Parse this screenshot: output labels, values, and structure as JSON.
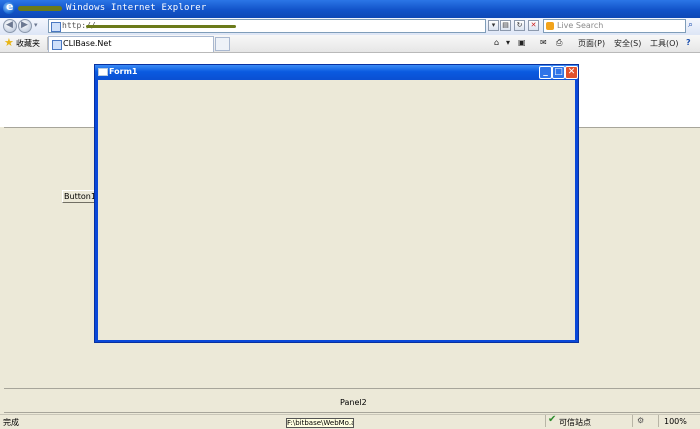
{
  "window": {
    "title": "Windows Internet Explorer",
    "logo_letter": "e"
  },
  "address_bar": {
    "url_prefix": "http://",
    "back_glyph": "◀",
    "forward_glyph": "▶",
    "dropdown_glyph": "▾",
    "refresh_glyph": "↻",
    "stop_glyph": "✕",
    "compat_glyph": "▤",
    "search_placeholder": "Live Search",
    "search_glyph": "⌕"
  },
  "command_bar": {
    "favorites_label": "收藏夹",
    "tab_label": "CLIBase.Net",
    "home_glyph": "⌂",
    "feeds_glyph": "▣",
    "mail_glyph": "✉",
    "print_glyph": "⎙",
    "page_menu": "页面(P)",
    "safety_menu": "安全(S)",
    "tools_menu": "工具(O)",
    "help_glyph": "?"
  },
  "page": {
    "button1_label": "Button1",
    "panel2_label": "Panel2"
  },
  "form1": {
    "title": "Form1",
    "minimize_glyph": "_",
    "maximize_glyph": "□",
    "close_glyph": "✕"
  },
  "status_bar": {
    "status_text": "完成",
    "tooltip_text": "F:\\bitbase\\WebMo.aspx",
    "zone_text": "可信站点",
    "zoom_text": "100%",
    "colors": {
      "check": "#2e8b2e",
      "titlebar": "#0a5ae0"
    }
  }
}
